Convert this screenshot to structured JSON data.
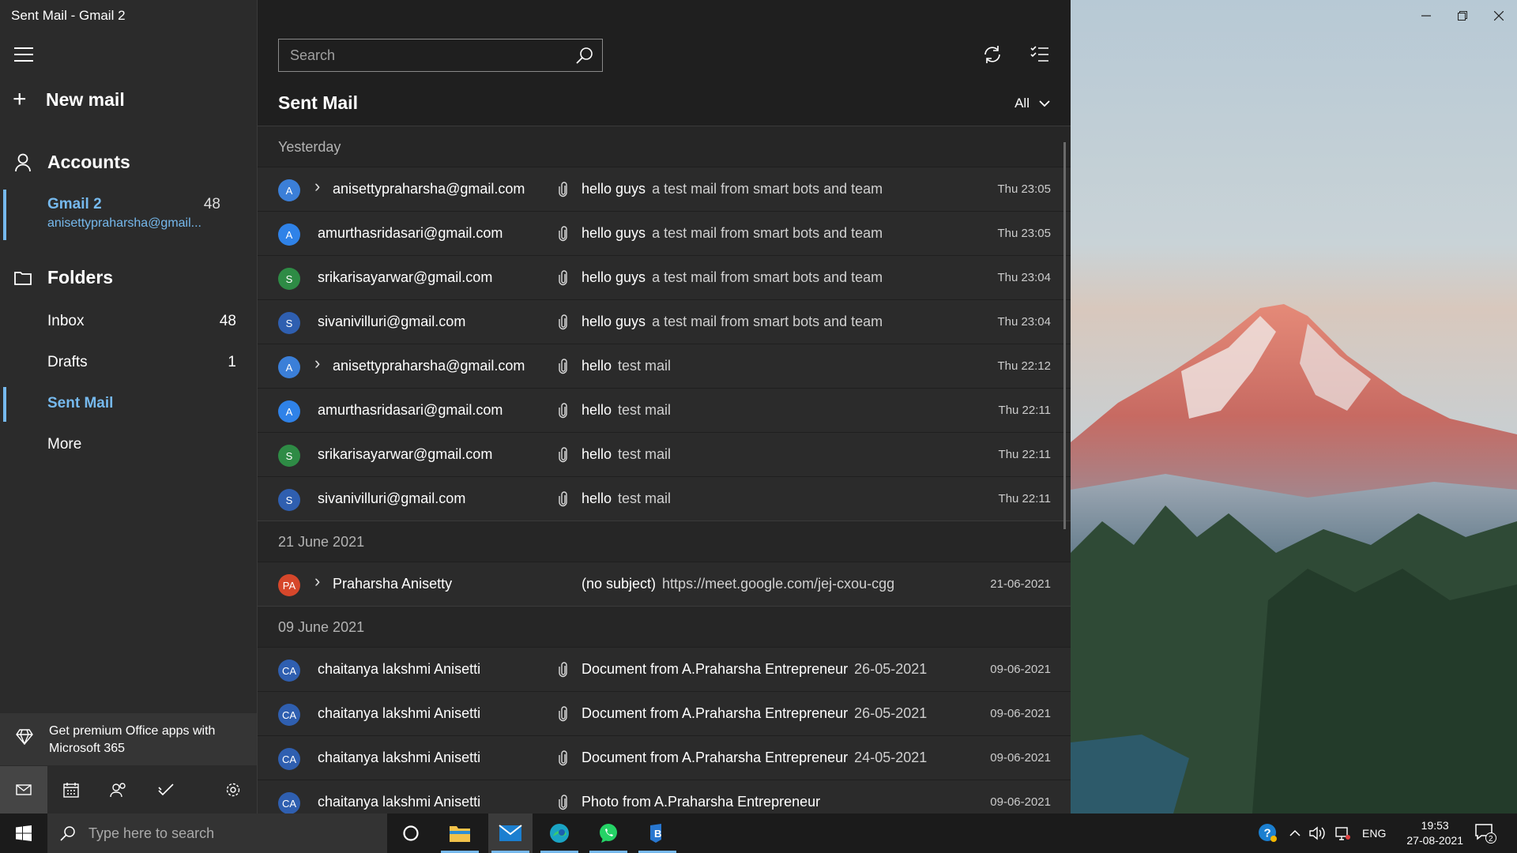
{
  "window": {
    "title": "Sent Mail - Gmail 2"
  },
  "nav": {
    "new_mail_label": "New mail",
    "accounts_label": "Accounts",
    "account": {
      "name": "Gmail 2",
      "email": "anisettypraharsha@gmail...",
      "count": "48"
    },
    "folders_label": "Folders",
    "folders": [
      {
        "label": "Inbox",
        "count": "48"
      },
      {
        "label": "Drafts",
        "count": "1"
      },
      {
        "label": "Sent Mail",
        "count": ""
      },
      {
        "label": "More",
        "count": ""
      }
    ],
    "premium_text": "Get premium Office apps with Microsoft 365"
  },
  "list": {
    "search_placeholder": "Search",
    "folder_title": "Sent Mail",
    "filter_label": "All",
    "groups": [
      {
        "header": "Yesterday",
        "rows": [
          {
            "initials": "A",
            "color": "#3b7fd8",
            "expand": true,
            "sender": "anisettypraharsha@gmail.com",
            "attach": true,
            "subject": "hello guys",
            "preview": "a test mail from smart bots and team",
            "date": "Thu 23:05"
          },
          {
            "initials": "A",
            "color": "#2f82e8",
            "expand": false,
            "sender": "amurthasridasari@gmail.com",
            "attach": true,
            "subject": "hello guys",
            "preview": "a test mail from smart bots and team",
            "date": "Thu 23:05"
          },
          {
            "initials": "S",
            "color": "#2e8b45",
            "expand": false,
            "sender": "srikarisayarwar@gmail.com",
            "attach": true,
            "subject": "hello guys",
            "preview": "a test mail from smart bots and team",
            "date": "Thu 23:04"
          },
          {
            "initials": "S",
            "color": "#2f5fb0",
            "expand": false,
            "sender": "sivanivilluri@gmail.com",
            "attach": true,
            "subject": "hello guys",
            "preview": "a test mail from smart bots and team",
            "date": "Thu 23:04"
          },
          {
            "initials": "A",
            "color": "#3b7fd8",
            "expand": true,
            "sender": "anisettypraharsha@gmail.com",
            "attach": true,
            "subject": "hello",
            "preview": "test mail",
            "date": "Thu 22:12"
          },
          {
            "initials": "A",
            "color": "#2f82e8",
            "expand": false,
            "sender": "amurthasridasari@gmail.com",
            "attach": true,
            "subject": "hello",
            "preview": "test mail",
            "date": "Thu 22:11"
          },
          {
            "initials": "S",
            "color": "#2e8b45",
            "expand": false,
            "sender": "srikarisayarwar@gmail.com",
            "attach": true,
            "subject": "hello",
            "preview": "test mail",
            "date": "Thu 22:11"
          },
          {
            "initials": "S",
            "color": "#2f5fb0",
            "expand": false,
            "sender": "sivanivilluri@gmail.com",
            "attach": true,
            "subject": "hello",
            "preview": "test mail",
            "date": "Thu 22:11"
          }
        ]
      },
      {
        "header": "21 June 2021",
        "rows": [
          {
            "initials": "PA",
            "color": "#d6472b",
            "expand": true,
            "sender": "Praharsha Anisetty",
            "attach": false,
            "subject": "(no subject)",
            "preview": "https://meet.google.com/jej-cxou-cgg",
            "date": "21-06-2021"
          }
        ]
      },
      {
        "header": "09 June 2021",
        "rows": [
          {
            "initials": "CA",
            "color": "#2f5fb0",
            "expand": false,
            "sender": "chaitanya lakshmi Anisetti",
            "attach": true,
            "subject": "Document from A.Praharsha Entrepreneur",
            "preview": "26-05-2021",
            "date": "09-06-2021"
          },
          {
            "initials": "CA",
            "color": "#2f5fb0",
            "expand": false,
            "sender": "chaitanya lakshmi Anisetti",
            "attach": true,
            "subject": "Document from A.Praharsha Entrepreneur",
            "preview": "26-05-2021",
            "date": "09-06-2021"
          },
          {
            "initials": "CA",
            "color": "#2f5fb0",
            "expand": false,
            "sender": "chaitanya lakshmi Anisetti",
            "attach": true,
            "subject": "Document from A.Praharsha Entrepreneur",
            "preview": "24-05-2021",
            "date": "09-06-2021"
          },
          {
            "initials": "CA",
            "color": "#2f5fb0",
            "expand": false,
            "sender": "chaitanya lakshmi Anisetti",
            "attach": true,
            "subject": "Photo from A.Praharsha Entrepreneur",
            "preview": "",
            "date": "09-06-2021"
          }
        ]
      }
    ]
  },
  "taskbar": {
    "search_placeholder": "Type here to search",
    "language": "ENG",
    "time": "19:53",
    "date": "27-08-2021",
    "notification_count": "2"
  },
  "colors": {
    "accent": "#76b9ed",
    "nav_bg": "#2b2b2b",
    "list_bg": "#1f1f1f",
    "row_bg": "#2b2b2b"
  }
}
